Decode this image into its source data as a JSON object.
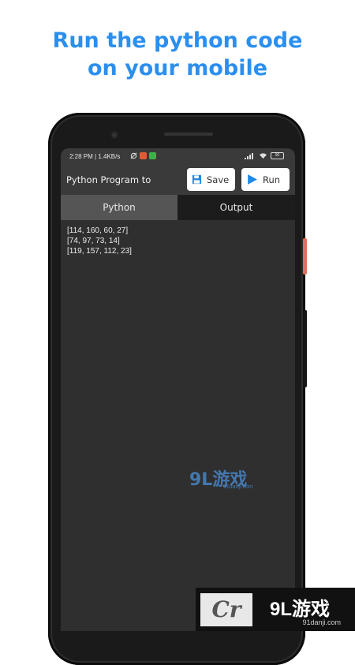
{
  "promo": {
    "line1": "Run the python code",
    "line2": "on your mobile"
  },
  "status_bar": {
    "time_speed": "2:28 PM | 1.4KB/s",
    "battery": "90"
  },
  "app": {
    "title": "Python Program to",
    "save_label": "Save",
    "run_label": "Run"
  },
  "tabs": [
    {
      "label": "Python",
      "selected": false
    },
    {
      "label": "Output",
      "selected": true
    }
  ],
  "output_lines": [
    "[114, 160, 60, 27]",
    "[74, 97, 73, 14]",
    "[119, 157, 112, 23]"
  ],
  "watermark": {
    "brand": "9L游戏",
    "site": "91danji.com"
  },
  "corner": {
    "logo_text": "Cr",
    "brand": "9L游戏",
    "site": "91danji.com"
  },
  "colors": {
    "headline": "#2b8ff0",
    "appbar": "#3a3a3a",
    "tab_inactive": "#555555",
    "tab_active": "#1c1c1c",
    "run_icon": "#1e88e5"
  },
  "icons": {
    "save": "floppy-disk-icon",
    "run": "play-icon"
  }
}
